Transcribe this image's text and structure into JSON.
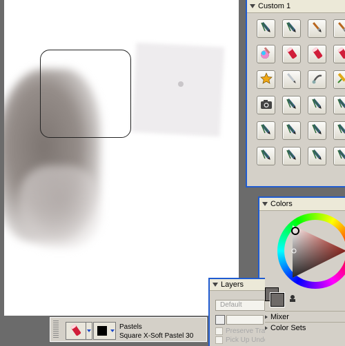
{
  "custom_palette": {
    "title": "Custom  1",
    "tiles": [
      "airbrush-variant-icon",
      "airbrush-variant-icon",
      "oil-brush-icon",
      "oil-brush-icon",
      "color-wheel-brush-icon",
      "pastel-icon",
      "pastel-icon",
      "pastel-icon",
      "star-icon",
      "pen-icon",
      "blender-icon",
      "pencil-icon",
      "camera-icon",
      "airbrush-variant-icon",
      "airbrush-variant-icon",
      "airbrush-variant-icon",
      "airbrush-variant-icon",
      "airbrush-variant-icon",
      "airbrush-variant-icon",
      "airbrush-variant-icon",
      "airbrush-variant-icon",
      "airbrush-variant-icon",
      "airbrush-variant-icon",
      "airbrush-variant-icon"
    ]
  },
  "colors_palette": {
    "title": "Colors",
    "mixer_label": "Mixer",
    "color_sets_label": "Color Sets",
    "main_color": "#6e6a68"
  },
  "layers_palette": {
    "title": "Layers",
    "blend_mode": "Default",
    "preserve_transparency": "Preserve Tra",
    "pick_up_underlying": "Pick Up Unde"
  },
  "property_bar": {
    "category": "Pastels",
    "variant": "Square X-Soft Pastel 30"
  },
  "colors": {
    "accent_border": "#1f5bd1",
    "panel_bg": "#d4d0c8",
    "desk_bg": "#6b6b6b"
  }
}
